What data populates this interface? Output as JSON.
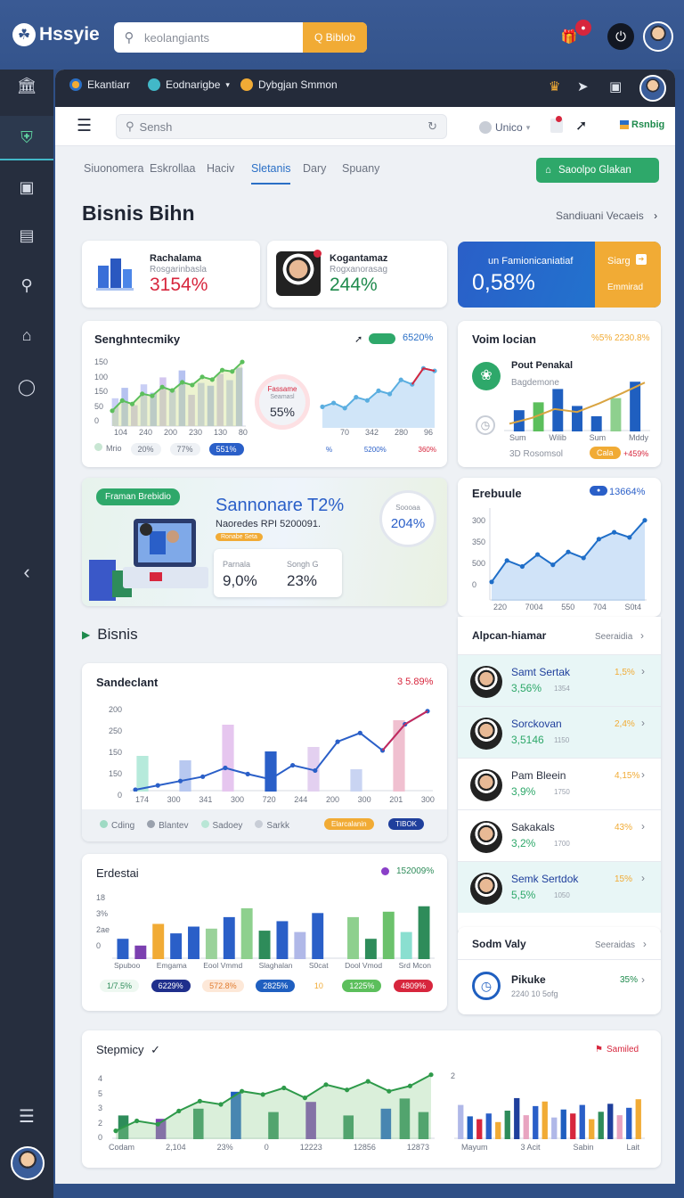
{
  "app": {
    "logo": "Hssyie",
    "search_placeholder": "keolangiants",
    "search_button": "Q Biblob"
  },
  "window_tabs": [
    "Ekantiarr",
    "Eodnarigbe",
    "Dybgjan Smmon"
  ],
  "toolbar": {
    "search_placeholder": "Sensh",
    "user_menu": "Unico",
    "brand_label": "Rsnbig"
  },
  "nav_tabs": [
    "Siuonomera",
    "Eskrollaa",
    "Haciv",
    "Sletanis",
    "Dary",
    "Spuany"
  ],
  "primary_button": "Saoolpo Glakan",
  "page_title": "Bisnis Bihn",
  "page_link": "Sandiuani Vecaeis",
  "kpis": [
    {
      "title": "Rachalama",
      "subtitle": "Rosgarinbasla",
      "value": "3154%",
      "color": "#d7263d"
    },
    {
      "title": "Kogantamaz",
      "subtitle": "Rogxanorasag",
      "value": "244%",
      "color": "#1e8a4c"
    }
  ],
  "promo_kpi": {
    "label": "un Famionicaniatiaf",
    "value": "0,58%",
    "side_title": "Siarg",
    "side_sub": "Emmirad"
  },
  "card_seg": {
    "title": "Senghntecmiky",
    "badge": "6520%",
    "y_ticks": [
      "150",
      "100",
      "150",
      "50",
      "0"
    ],
    "x_ticks": [
      "104",
      "240",
      "200",
      "230",
      "130",
      "80"
    ],
    "ring_label": "Fassame",
    "ring_sub": "Seamasl",
    "ring_value": "55%",
    "legend": [
      "Mrio",
      "20%",
      "77%",
      "551%"
    ],
    "right_x_ticks": [
      "70",
      "342",
      "280",
      "96"
    ],
    "right_legend": [
      "%",
      "5200%",
      "360%"
    ],
    "bars": [
      40,
      55,
      30,
      60,
      48,
      70,
      52,
      80,
      45,
      62,
      58,
      75,
      66,
      84
    ],
    "line": [
      20,
      35,
      30,
      45,
      42,
      55,
      50,
      62,
      58,
      70,
      66,
      80,
      78,
      92
    ],
    "right_line": [
      30,
      36,
      28,
      45,
      40,
      55,
      50,
      72,
      65,
      90,
      86
    ]
  },
  "card_vol": {
    "title": "Voim locian",
    "badge1": "%5%",
    "badge2": "2230.8%",
    "icon_title": "Pout Penakal",
    "icon_sub": "Bagdemone",
    "x_ticks": [
      "Sum",
      "Wilib",
      "Sum",
      "Mddy"
    ],
    "footer": "3D Rosomsol",
    "footer_badge": "Cala",
    "footer_value": "+459%",
    "bars": [
      35,
      48,
      70,
      42,
      25,
      55,
      82
    ],
    "line": [
      10,
      20,
      35,
      30,
      45,
      62,
      80
    ]
  },
  "banner": {
    "tag": "Framan Brebidio",
    "title": "Sannonare T2%",
    "subtitle": "Naoredes RPI 5200091.",
    "chip": "Ronabe Seta",
    "ring_label": "Soooaa",
    "ring_value": "204%",
    "stat1_label": "Parnala",
    "stat1_value": "9,0%",
    "stat2_label": "Songh G",
    "stat2_value": "23%"
  },
  "card_ere": {
    "title": "Erebuule",
    "badge": "13664%",
    "y_ticks": [
      "300",
      "350",
      "500",
      "0"
    ],
    "x_ticks": [
      "220",
      "7004",
      "550",
      "704",
      "S0t4"
    ],
    "line": [
      20,
      45,
      38,
      52,
      40,
      55,
      48,
      70,
      78,
      72,
      92
    ]
  },
  "section_title": "Bisnis",
  "card_sand": {
    "title": "Sandeclant",
    "badge": "3 5.89%",
    "y_ticks": [
      "200",
      "250",
      "150",
      "150",
      "0"
    ],
    "x_ticks": [
      "174",
      "300",
      "341",
      "300",
      "720",
      "244",
      "200",
      "300",
      "201",
      "300"
    ],
    "legend": [
      "Cding",
      "Blantev",
      "Sadoey",
      "Sarkk"
    ],
    "legend_badge1": "Elarcalanin",
    "legend_badge2": "TIBOK",
    "bars": [
      40,
      0,
      35,
      0,
      75,
      0,
      45,
      0,
      50,
      0,
      25,
      0,
      80,
      0
    ],
    "line": [
      0,
      5,
      10,
      15,
      25,
      18,
      12,
      28,
      22,
      55,
      65,
      45,
      75,
      90
    ]
  },
  "card_ales": {
    "title": "Alpcan-hiamar",
    "link": "Seeraidia",
    "people": [
      {
        "name": "Samt Sertak",
        "value": "3,56%",
        "meta": "1354",
        "change": "1,5%",
        "highlight": true
      },
      {
        "name": "Sorckovan",
        "value": "3,5146",
        "meta": "1150",
        "change": "2,4%",
        "highlight": true
      },
      {
        "name": "Pam Bleein",
        "value": "3,9%",
        "meta": "1750",
        "change": "4,15%",
        "highlight": false
      },
      {
        "name": "Sakakals",
        "value": "3,2%",
        "meta": "1700",
        "change": "43%",
        "highlight": false
      },
      {
        "name": "Semk Sertdok",
        "value": "5,5%",
        "meta": "1050",
        "change": "15%",
        "highlight": true
      }
    ]
  },
  "card_sodm": {
    "title": "Sodm Valy",
    "link": "Seeraidas",
    "item_title": "Pikuke",
    "item_meta": "2240 10 5ofg",
    "item_value": "35%"
  },
  "card_erd": {
    "title": "Erdestai",
    "badge": "152009%",
    "y_ticks": [
      "18",
      "3%",
      "2ae",
      "0"
    ],
    "x_ticks": [
      "Spuboo",
      "Emgama",
      "Eool Vmmd",
      "Slaghalan",
      "S0cat",
      "Dool Vmod",
      "Srd Mcon"
    ],
    "pills": [
      "1/7.5%",
      "6229%",
      "572.8%",
      "2825%",
      "10",
      "1225%",
      "4809%"
    ],
    "bars": [
      30,
      20,
      52,
      38,
      48,
      45,
      62,
      75,
      42,
      56,
      40,
      68,
      0,
      62,
      30,
      70,
      40,
      78
    ]
  },
  "card_steu": {
    "title": "Stepmicy",
    "badge": "Samiled",
    "y_ticks": [
      "4",
      "5",
      "3",
      "2",
      "0"
    ],
    "x_ticks": [
      "Codam",
      "2,104",
      "23%",
      "0",
      "12223",
      "12856",
      "12873"
    ],
    "right_x_ticks": [
      "Mayum",
      "3 Acit",
      "Sabin",
      "Lait"
    ],
    "right_y": "2",
    "bars": [
      35,
      0,
      30,
      0,
      45,
      0,
      70,
      0,
      40,
      0,
      55,
      0,
      35,
      0,
      45,
      60,
      40
    ],
    "line": [
      10,
      25,
      20,
      40,
      55,
      50,
      70,
      65,
      75,
      60,
      80,
      72,
      85,
      70,
      78,
      95
    ],
    "right_bars": [
      60,
      40,
      35,
      45,
      30,
      50,
      72,
      42,
      58,
      66,
      38,
      52,
      45,
      60,
      35,
      48,
      62,
      42,
      55,
      70
    ]
  }
}
